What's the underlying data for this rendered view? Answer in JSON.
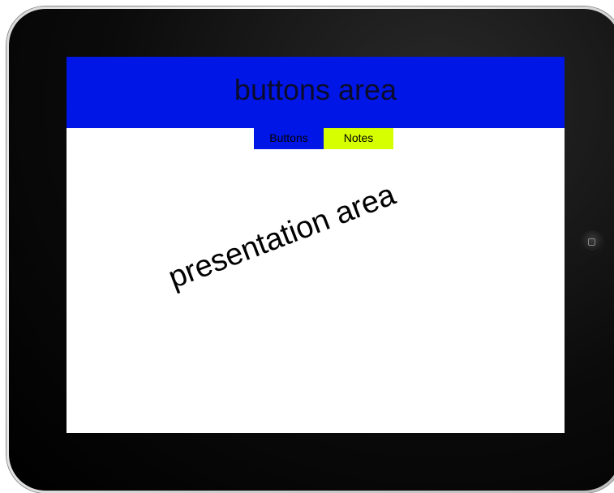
{
  "screen": {
    "header": {
      "label": "buttons area",
      "color": "#0016e6"
    },
    "tabs": [
      {
        "label": "Buttons",
        "color": "#0016e6"
      },
      {
        "label": "Notes",
        "color": "#d6ff00"
      }
    ],
    "presentation": {
      "label": "presentation area"
    }
  },
  "device": {
    "home_icon": "home-button-icon"
  }
}
